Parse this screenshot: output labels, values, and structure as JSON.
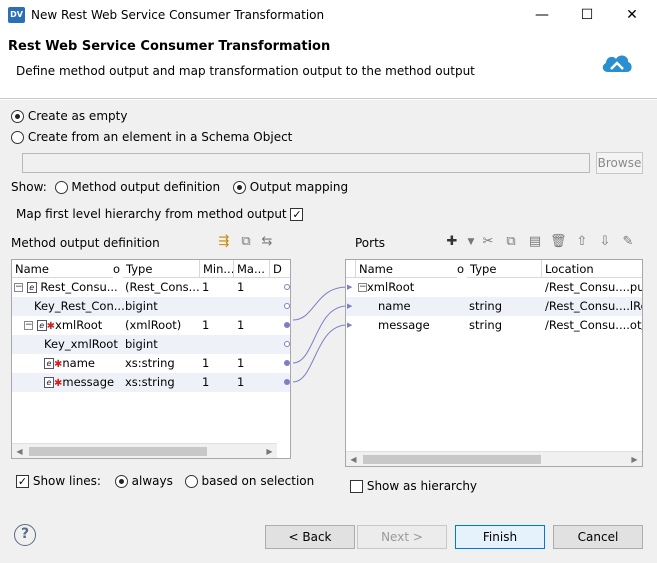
{
  "window": {
    "app_icon": "DV",
    "title": "New Rest Web Service Consumer Transformation",
    "minimize": "—",
    "maximize": "☐",
    "close": "✕"
  },
  "header": {
    "title": "Rest Web Service Consumer Transformation",
    "description": "Define method output and map transformation output to the method output"
  },
  "options": {
    "create_empty": "Create as empty",
    "create_from_schema": "Create from an element in a Schema Object",
    "schema_field_value": "",
    "browse": "Browse",
    "show_label": "Show:",
    "show_method_output": "Method output definition",
    "show_output_mapping": "Output mapping",
    "map_first_level": "Map first level hierarchy from method output"
  },
  "method_output": {
    "title": "Method output definition",
    "columns": [
      "Name",
      "o",
      "Type",
      "Min...",
      "Ma...",
      "D"
    ],
    "rows": [
      {
        "name": "Rest_Consu...",
        "type": "(Rest_Cons...",
        "min": "1",
        "max": "1"
      },
      {
        "name": "Key_Rest_Con...",
        "type": "bigint",
        "min": "",
        "max": ""
      },
      {
        "name": "xmlRoot",
        "type": "(xmlRoot)",
        "min": "1",
        "max": "1"
      },
      {
        "name": "Key_xmlRoot",
        "type": "bigint",
        "min": "",
        "max": ""
      },
      {
        "name": "name",
        "type": "xs:string",
        "min": "1",
        "max": "1"
      },
      {
        "name": "message",
        "type": "xs:string",
        "min": "1",
        "max": "1"
      }
    ],
    "show_lines": "Show lines:",
    "always": "always",
    "based_on_selection": "based on selection"
  },
  "ports": {
    "title": "Ports",
    "columns": [
      "Name",
      "o",
      "Type",
      "Location"
    ],
    "rows": [
      {
        "name": "xmlRoot",
        "type": "",
        "location": "/Rest_Consu....put/"
      },
      {
        "name": "name",
        "type": "string",
        "location": "/Rest_Consu....lRoo"
      },
      {
        "name": "message",
        "type": "string",
        "location": "/Rest_Consu....ot/m"
      }
    ],
    "show_as_hierarchy": "Show as hierarchy"
  },
  "buttons": {
    "help": "?",
    "back": "< Back",
    "next": "Next >",
    "finish": "Finish",
    "cancel": "Cancel"
  },
  "icons": {
    "cloud": "cloud-arrow-icon",
    "mapping_link": "#7e7ec8"
  }
}
